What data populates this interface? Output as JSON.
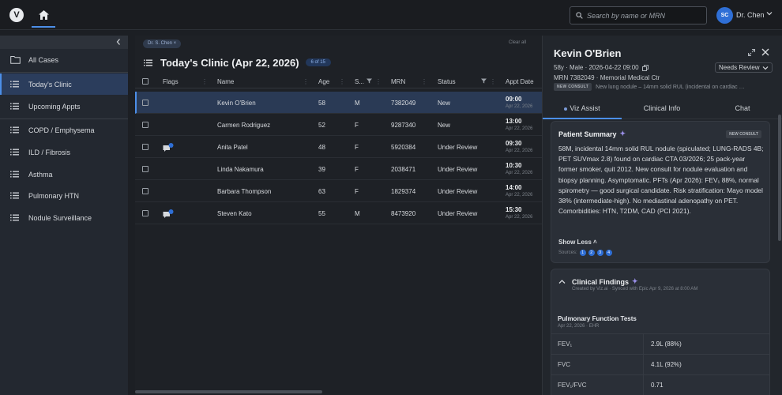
{
  "topbar": {
    "logo_letter": "V",
    "search_placeholder": "Search by name or MRN",
    "user_initials": "SC",
    "user_name": "Dr. Chen"
  },
  "sidebar": {
    "items": [
      {
        "label": "All Cases",
        "icon": "folder-icon"
      },
      {
        "label": "Today's Clinic",
        "icon": "list-icon",
        "active": true
      },
      {
        "label": "Upcoming Appts",
        "icon": "list-icon"
      },
      {
        "label": "COPD / Emphysema",
        "icon": "list-icon"
      },
      {
        "label": "ILD / Fibrosis",
        "icon": "list-icon"
      },
      {
        "label": "Asthma",
        "icon": "list-icon"
      },
      {
        "label": "Pulmonary HTN",
        "icon": "list-icon"
      },
      {
        "label": "Nodule Surveillance",
        "icon": "list-icon"
      }
    ]
  },
  "main": {
    "filter_chip": "Dr. S. Chen ×",
    "clear_all": "Clear all",
    "title": "Today's Clinic (Apr 22, 2026)",
    "count": "6 of 15",
    "columns": [
      "Flags",
      "Name",
      "Age",
      "S...",
      "MRN",
      "Status",
      "Appt Date"
    ],
    "rows": [
      {
        "name": "Kevin O'Brien",
        "age": "58",
        "sex": "M",
        "mrn": "7382049",
        "status": "New",
        "time": "09:00",
        "date": "Apr 22, 2026",
        "flag": false,
        "selected": true
      },
      {
        "name": "Carmen Rodriguez",
        "age": "52",
        "sex": "F",
        "mrn": "9287340",
        "status": "New",
        "time": "13:00",
        "date": "Apr 22, 2026",
        "flag": false
      },
      {
        "name": "Anita Patel",
        "age": "48",
        "sex": "F",
        "mrn": "5920384",
        "status": "Under Review",
        "time": "09:30",
        "date": "Apr 22, 2026",
        "flag": true,
        "flag_count": "1"
      },
      {
        "name": "Linda Nakamura",
        "age": "39",
        "sex": "F",
        "mrn": "2038471",
        "status": "Under Review",
        "time": "10:30",
        "date": "Apr 22, 2026",
        "flag": false
      },
      {
        "name": "Barbara Thompson",
        "age": "63",
        "sex": "F",
        "mrn": "1829374",
        "status": "Under Review",
        "time": "14:00",
        "date": "Apr 22, 2026",
        "flag": false
      },
      {
        "name": "Steven Kato",
        "age": "55",
        "sex": "M",
        "mrn": "8473920",
        "status": "Under Review",
        "time": "15:30",
        "date": "Apr 22, 2026",
        "flag": true,
        "flag_count": "1"
      }
    ]
  },
  "panel": {
    "name": "Kevin O'Brien",
    "meta": "58y · Male · 2026-04-22 09:00",
    "status_select": "Needs Review",
    "mrn_line": "MRN 7382049 · Memorial Medical Ctr",
    "consult_tag": "NEW CONSULT",
    "consult_text": "New lung nodule – 14mm solid RUL (incidental on cardiac …",
    "tabs": [
      "Viz Assist",
      "Clinical Info",
      "Chat"
    ],
    "summary": {
      "title": "Patient Summary",
      "badge": "NEW CONSULT",
      "text": "58M, incidental 14mm solid RUL nodule (spiculated; LUNG-RADS 4B; PET SUVmax 2.8) found on cardiac CTA 03/2026; 25 pack-year former smoker, quit 2012. New consult for nodule evaluation and biopsy planning. Asymptomatic. PFTs (Apr 2026): FEV₁ 88%, normal spirometry — good surgical candidate. Risk stratification: Mayo model 38% (intermediate-high). No mediastinal adenopathy on PET. Comorbidities: HTN, T2DM, CAD (PCI 2021).",
      "show_less": "Show Less ˄",
      "sources_label": "Sources:",
      "sources": [
        "1",
        "2",
        "3",
        "4"
      ]
    },
    "findings": {
      "title": "Clinical Findings",
      "subtitle": "Created by Viz.ai · Synced with Epic Apr 9, 2026 at 8:00 AM",
      "pft_title": "Pulmonary Function Tests",
      "pft_sub": "Apr 22, 2026 · EHR",
      "pft_rows": [
        {
          "label": "FEV₁",
          "value": "2.9L (88%)"
        },
        {
          "label": "FVC",
          "value": "4.1L (92%)"
        },
        {
          "label": "FEV₁/FVC",
          "value": "0.71"
        }
      ]
    }
  }
}
